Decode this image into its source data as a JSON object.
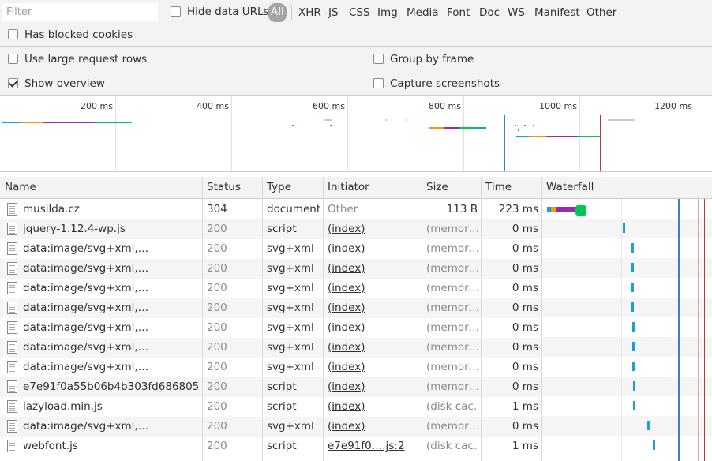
{
  "toolbar": {
    "filter_placeholder": "Filter",
    "hide_data_urls": "Hide data URLs",
    "types": [
      "All",
      "XHR",
      "JS",
      "CSS",
      "Img",
      "Media",
      "Font",
      "Doc",
      "WS",
      "Manifest",
      "Other"
    ],
    "has_blocked_cookies": "Has blocked cookies"
  },
  "settings": {
    "use_large_request_rows": "Use large request rows",
    "show_overview": "Show overview",
    "group_by_frame": "Group by frame",
    "capture_screenshots": "Capture screenshots",
    "show_overview_checked": true
  },
  "overview": {
    "ticks": [
      "200 ms",
      "400 ms",
      "600 ms",
      "800 ms",
      "1000 ms",
      "1200 ms"
    ]
  },
  "table": {
    "headers": [
      "Name",
      "Status",
      "Type",
      "Initiator",
      "Size",
      "Time",
      "Waterfall"
    ],
    "rows": [
      {
        "name": "musilda.cz",
        "status": "304",
        "type": "document",
        "initiator": "Other",
        "size": "113 B",
        "time": "223 ms"
      },
      {
        "name": "jquery-1.12.4-wp.js",
        "status": "200",
        "type": "script",
        "initiator": "(index)",
        "size": "(memor…",
        "time": "0 ms"
      },
      {
        "name": "data:image/svg+xml,…",
        "status": "200",
        "type": "svg+xml",
        "initiator": "(index)",
        "size": "(memor…",
        "time": "0 ms"
      },
      {
        "name": "data:image/svg+xml,…",
        "status": "200",
        "type": "svg+xml",
        "initiator": "(index)",
        "size": "(memor…",
        "time": "0 ms"
      },
      {
        "name": "data:image/svg+xml,…",
        "status": "200",
        "type": "svg+xml",
        "initiator": "(index)",
        "size": "(memor…",
        "time": "0 ms"
      },
      {
        "name": "data:image/svg+xml,…",
        "status": "200",
        "type": "svg+xml",
        "initiator": "(index)",
        "size": "(memor…",
        "time": "0 ms"
      },
      {
        "name": "data:image/svg+xml,…",
        "status": "200",
        "type": "svg+xml",
        "initiator": "(index)",
        "size": "(memor…",
        "time": "0 ms"
      },
      {
        "name": "data:image/svg+xml,…",
        "status": "200",
        "type": "svg+xml",
        "initiator": "(index)",
        "size": "(memor…",
        "time": "0 ms"
      },
      {
        "name": "data:image/svg+xml,…",
        "status": "200",
        "type": "svg+xml",
        "initiator": "(index)",
        "size": "(memor…",
        "time": "0 ms"
      },
      {
        "name": "e7e91f0a55b06b4b303fd686805…",
        "status": "200",
        "type": "script",
        "initiator": "(index)",
        "size": "(memor…",
        "time": "0 ms"
      },
      {
        "name": "lazyload.min.js",
        "status": "200",
        "type": "script",
        "initiator": "(index)",
        "size": "(disk cac…",
        "time": "1 ms"
      },
      {
        "name": "data:image/svg+xml,…",
        "status": "200",
        "type": "svg+xml",
        "initiator": "(index)",
        "size": "(memor…",
        "time": "0 ms"
      },
      {
        "name": "webfont.js",
        "status": "200",
        "type": "script",
        "initiator": "e7e91f0….js:2",
        "size": "(disk cac…",
        "time": "1 ms"
      }
    ]
  },
  "colors": {
    "dom_content_loaded": "#3d7fcf",
    "load": "#b33a3a",
    "waiting": "#00c853",
    "receiving": "#1a9fd6",
    "queueing": "#ff9800",
    "stalled": "#9c27b0"
  }
}
